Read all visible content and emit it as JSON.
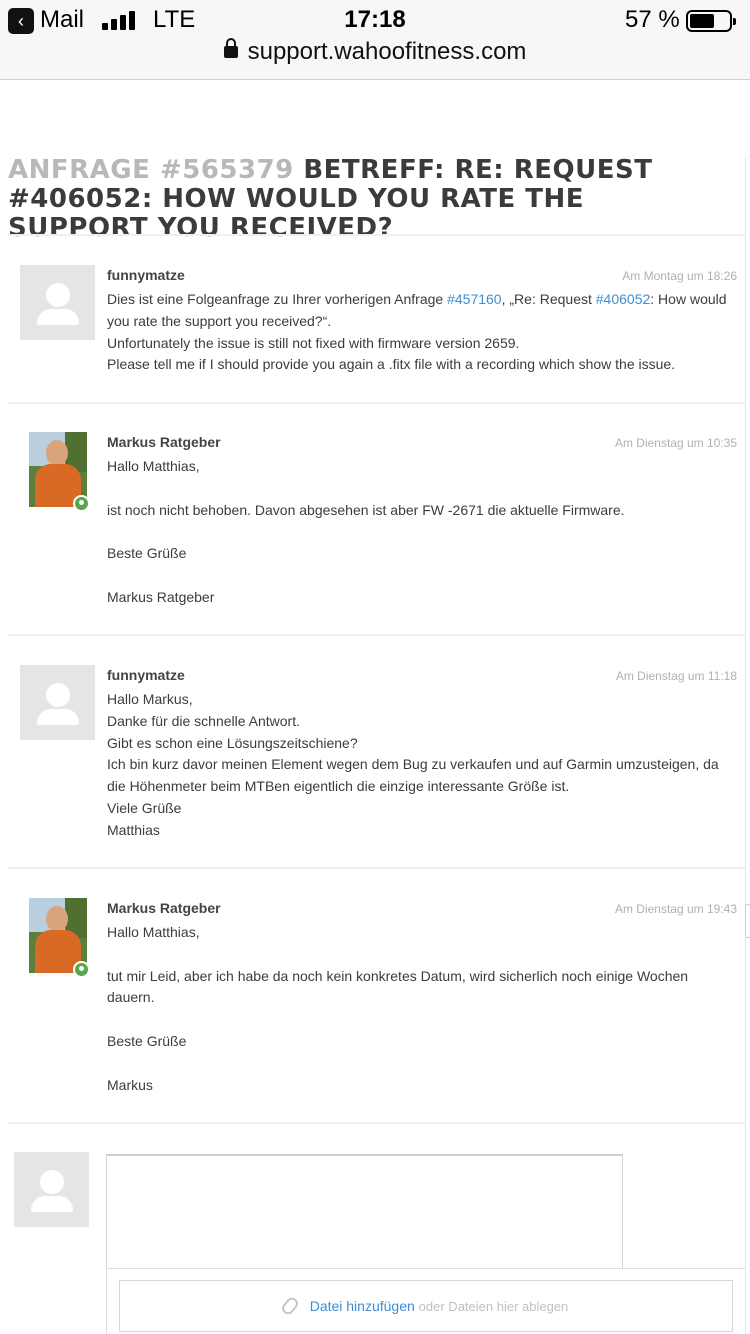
{
  "status_bar": {
    "back_app": "Mail",
    "network": "LTE",
    "time": "17:18",
    "battery_percent": "57 %",
    "battery_level": 0.57,
    "signal_bars": 4
  },
  "browser": {
    "url": "support.wahoofitness.com"
  },
  "page": {
    "title_request": "Anfrage #565379",
    "title_subject": "Betreff: Re: Request #406052: How would you rate the support you received?"
  },
  "messages": [
    {
      "author": "funnymatze",
      "date": "Am Montag um 18:26",
      "intro_pre": "Dies ist eine Folgeanfrage zu Ihrer vorherigen Anfrage ",
      "intro_link1": "#457160",
      "intro_mid": ", „Re: Request",
      "intro_link2": "#406052",
      "intro_post": ": How would you rate the support you received?“.",
      "lines": [
        "Unfortunately the issue is still not fixed with firmware version 2659.",
        "Please tell me if I should provide you again a .fitx file with a recording which show the issue."
      ]
    },
    {
      "author": "Markus Ratgeber",
      "date": "Am Dienstag um 10:35",
      "greeting": "Hallo Matthias,",
      "text": "ist noch nicht behoben. Davon abgesehen ist aber FW -2671 die aktuelle Firmware.",
      "closing": "Beste Grüße",
      "signature": "Markus Ratgeber"
    },
    {
      "author": "funnymatze",
      "date": "Am Dienstag um 11:18",
      "lines": [
        "Hallo Markus,",
        "Danke für die schnelle Antwort.",
        "Gibt es schon eine Lösungszeitschiene?",
        "Ich bin kurz davor meinen Element wegen dem Bug zu verkaufen und auf Garmin umzusteigen, da die Höhenmeter beim MTBen eigentlich die einzige interessante Größe ist.",
        "Viele Grüße",
        "Matthias"
      ]
    },
    {
      "author": "Markus Ratgeber",
      "date": "Am Dienstag um 19:43",
      "greeting": "Hallo Matthias,",
      "text": "tut mir Leid, aber ich habe da noch kein konkretes Datum, wird sicherlich noch einige Wochen dauern.",
      "closing": "Beste Grüße",
      "signature": "Markus"
    }
  ],
  "composer": {
    "attach_label": "Datei hinzufügen",
    "drop_hint": "oder Dateien hier ablegen"
  },
  "colors": {
    "link": "#3d8ed4",
    "online_badge": "#5aa74a",
    "title_request": "#b8b8b8"
  }
}
